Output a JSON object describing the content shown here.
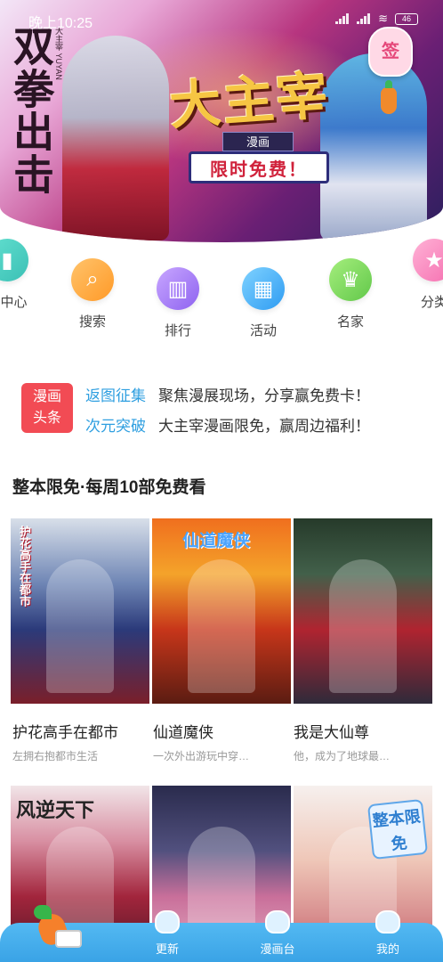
{
  "status_bar": {
    "time": "晚上10:25",
    "battery": "46"
  },
  "hero": {
    "vertical_title": "双拳出击",
    "vertical_small": "大主宰 YUYAN",
    "main_title": "大主宰",
    "tag": "漫画",
    "promo": "限时免费！",
    "sign_badge": "签"
  },
  "shortcuts": [
    {
      "label": "利中心",
      "icon": "welfare-icon"
    },
    {
      "label": "搜索",
      "icon": "search-icon"
    },
    {
      "label": "排行",
      "icon": "rank-icon"
    },
    {
      "label": "活动",
      "icon": "calendar-icon"
    },
    {
      "label": "名家",
      "icon": "master-icon"
    },
    {
      "label": "分类",
      "icon": "star-icon"
    }
  ],
  "news": {
    "badge_line1": "漫画",
    "badge_line2": "头条",
    "items": [
      {
        "tag": "返图征集",
        "text": "聚焦漫展现场，分享赢免费卡！"
      },
      {
        "tag": "次元突破",
        "text": "大主宰漫画限免，赢周边福利！"
      }
    ]
  },
  "section": {
    "title": "整本限免·每周10部免费看",
    "comics": [
      {
        "title": "护花高手在都市",
        "desc": "左拥右抱都市生活",
        "cover_text": "护花高手在都市"
      },
      {
        "title": "仙道魔侠",
        "desc": "一次外出游玩中穿…",
        "cover_text": "仙道魔侠"
      },
      {
        "title": "我是大仙尊",
        "desc": "他，成为了地球最…",
        "cover_text": ""
      },
      {
        "title": "",
        "desc": "",
        "cover_text": "风逆天下"
      },
      {
        "title": "",
        "desc": "",
        "cover_text": ""
      },
      {
        "title": "",
        "desc": "",
        "cover_text": "整本限免"
      }
    ]
  },
  "bottom_nav": {
    "items": [
      {
        "label": "更新"
      },
      {
        "label": "漫画台"
      },
      {
        "label": "我的"
      }
    ]
  }
}
